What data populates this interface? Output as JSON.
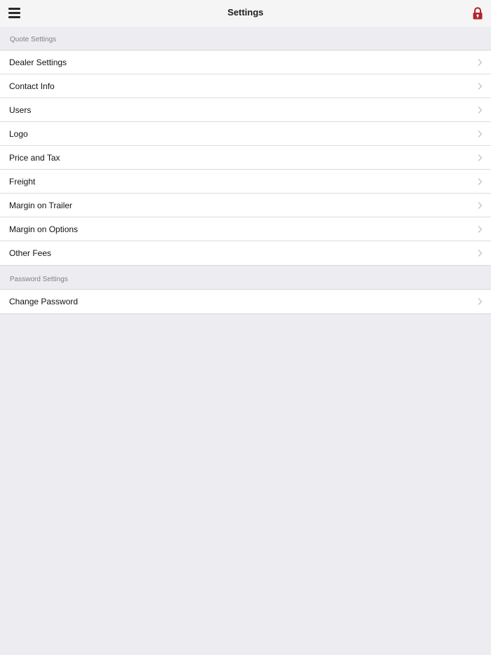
{
  "navbar": {
    "title": "Settings",
    "menu_icon": "hamburger-menu-icon",
    "lock_icon": "lock-icon",
    "lock_color": "#b3232b"
  },
  "sections": [
    {
      "header": "Quote Settings",
      "items": [
        {
          "label": "Dealer Settings"
        },
        {
          "label": "Contact Info"
        },
        {
          "label": "Users"
        },
        {
          "label": "Logo"
        },
        {
          "label": "Price and Tax"
        },
        {
          "label": "Freight"
        },
        {
          "label": "Margin on Trailer"
        },
        {
          "label": "Margin on Options"
        },
        {
          "label": "Other Fees"
        }
      ]
    },
    {
      "header": "Password Settings",
      "items": [
        {
          "label": "Change Password"
        }
      ]
    }
  ],
  "colors": {
    "background": "#ececf1",
    "navbar": "#f5f5f5",
    "row": "#ffffff",
    "section_header_text": "#7f7f84",
    "chevron": "#c4c4c7"
  }
}
